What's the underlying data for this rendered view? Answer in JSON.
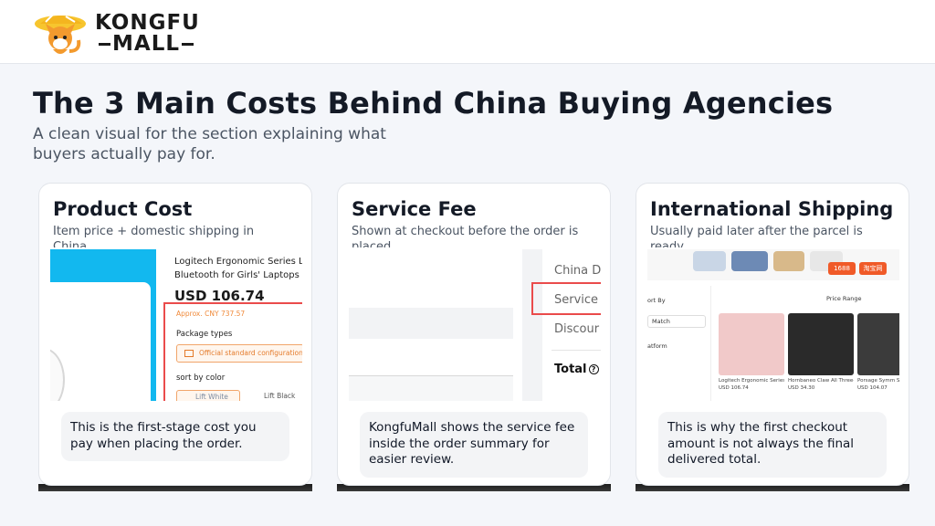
{
  "brand": {
    "name_line1": "KONGFU",
    "name_line2": "MALL"
  },
  "header": {
    "title": "The 3 Main Costs Behind China Buying Agencies",
    "subtitle": "A clean visual for the section explaining what buyers actually pay for."
  },
  "cards": [
    {
      "title": "Product Cost",
      "subtitle": "Item price + domestic shipping in China",
      "note": "This is the first-stage cost you pay when placing the order.",
      "shot": {
        "product_name": "Logitech Ergonomic Series L",
        "product_name2": "Bluetooth for Girls' Laptops a",
        "price": "USD 106.74",
        "approx": "Approx. CNY 737.57",
        "package_label": "Package types",
        "package_option": "Official standard configuration",
        "sort_label": "sort by color",
        "color1": "Lift White",
        "color2": "Lift Black"
      }
    },
    {
      "title": "Service Fee",
      "subtitle": "Shown at checkout before the order is placed",
      "note": "KongfuMall shows the service fee inside the order summary for easier review.",
      "shot": {
        "row1": "China D",
        "row2": "Service",
        "row3": "Discour",
        "total": "Total"
      }
    },
    {
      "title": "International Shipping",
      "subtitle": "Usually paid later after the parcel is ready",
      "note": "This is why the first checkout amount is not always the final delivered total.",
      "shot": {
        "badge1": "1688",
        "badge2": "淘宝网",
        "sort_by": "ort By",
        "match": "Match",
        "platform": "atform",
        "price_range": "Price Range",
        "item1": "Logitech Ergonomic Series Lift Wireless...",
        "item1_price": "USD 106.74",
        "item2": "Hornbaneo Claw All Three-Mode Wireless...",
        "item2_price": "USD 34.30",
        "item3": "Porsage Symm Swappable Mic",
        "item3_price": "USD 104.07"
      }
    }
  ],
  "colors": {
    "highlight_red": "#ea4b4b",
    "accent_blue": "#12b8ef",
    "accent_orange": "#f08a3a"
  }
}
